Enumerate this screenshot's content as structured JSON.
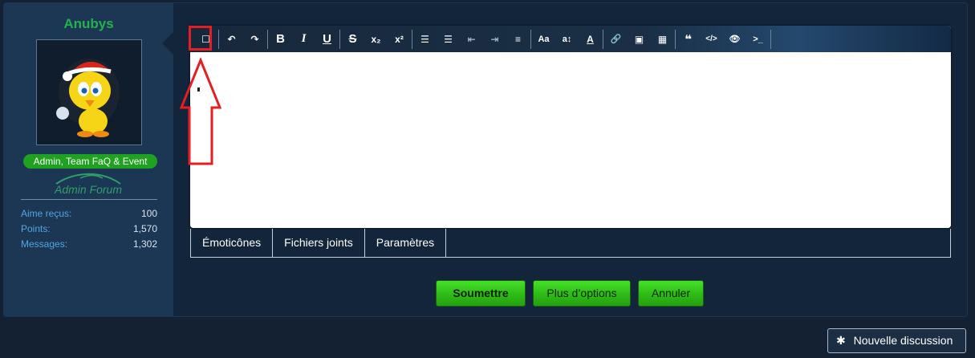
{
  "page": {
    "star_glyph": "★"
  },
  "user": {
    "name": "Anubys",
    "role": "Admin, Team FaQ & Event",
    "admin_logo": "Admin Forum",
    "stats": [
      {
        "label": "Aime reçus:",
        "value": "100"
      },
      {
        "label": "Points:",
        "value": "1,570"
      },
      {
        "label": "Messages:",
        "value": "1,302"
      }
    ]
  },
  "toolbar": {
    "source_toggle": "☐",
    "undo": "↶",
    "redo": "↷",
    "bold": "B",
    "italic": "I",
    "underline": "U",
    "strike": "S",
    "subscript": "x₂",
    "superscript": "x²",
    "ordered_list": "☰",
    "bullet_list": "☰",
    "outdent": "⇤",
    "indent": "⇥",
    "align": "≡",
    "font": "Aa",
    "font_size": "a↕",
    "font_color": "A",
    "link": "🔗",
    "image": "▣",
    "table": "▦",
    "quote": "❝",
    "code": "</>",
    "hide": "👁",
    "terminal": ">_"
  },
  "tabs": [
    "Émoticônes",
    "Fichiers joints",
    "Paramètres"
  ],
  "actions": {
    "submit": "Soumettre",
    "more_options": "Plus d’options",
    "cancel": "Annuler"
  },
  "new_discussion": {
    "icon": "✱",
    "label": "Nouvelle discussion"
  },
  "colors": {
    "username": "#22b14c",
    "accent_green": "#2fbe17",
    "highlight_red": "#e31e24",
    "label_blue": "#4fa6e0"
  }
}
